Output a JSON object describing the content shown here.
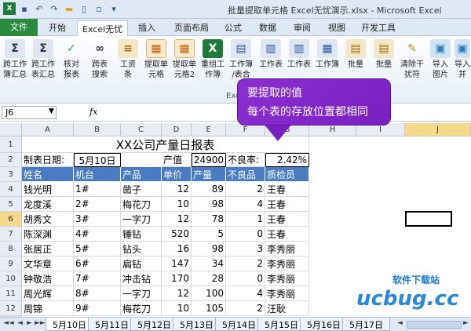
{
  "window": {
    "title": "批量提取单元格 Excel无忧演示.xlsx - Microsoft Excel"
  },
  "tabs": [
    "文件",
    "开始",
    "Excel无忧",
    "插入",
    "页面布局",
    "公式",
    "数据",
    "审阅",
    "视图",
    "开发工具"
  ],
  "ribbon_buttons": [
    {
      "l1": "跨工作",
      "l2": "簿汇总",
      "icon": "sum-icon"
    },
    {
      "l1": "跨工作",
      "l2": "表汇总",
      "icon": "sum-icon"
    },
    {
      "l1": "核对",
      "l2": "报表",
      "icon": "check-icon"
    },
    {
      "l1": "跨表",
      "l2": "搜索",
      "icon": "binoculars-icon"
    },
    {
      "l1": "工资",
      "l2": "条",
      "icon": "payslip-icon"
    },
    {
      "l1": "提取单",
      "l2": "元格",
      "icon": "extract-icon"
    },
    {
      "l1": "提取单",
      "l2": "元格2",
      "icon": "extract-icon"
    },
    {
      "l1": "重组工",
      "l2": "作簿",
      "icon": "excel-icon"
    },
    {
      "l1": "工作簿",
      "l2": "/表合并",
      "icon": "merge-icon"
    },
    {
      "l1": "工作表",
      "l2": "",
      "icon": "sheet-icon"
    },
    {
      "l1": "工作表",
      "l2": "",
      "icon": "sheet-icon"
    },
    {
      "l1": "工作簿",
      "l2": "",
      "icon": "workbook-icon"
    },
    {
      "l1": "批量",
      "l2": "",
      "icon": "batch-icon"
    },
    {
      "l1": "批量",
      "l2": "",
      "icon": "batch-icon"
    },
    {
      "l1": "清除干",
      "l2": "扰符",
      "icon": "broom-icon"
    },
    {
      "l1": "导入",
      "l2": "图片",
      "icon": "image-icon"
    },
    {
      "l1": "导入",
      "l2": "并",
      "icon": "image-icon"
    }
  ],
  "group_label": "Exce",
  "namebox": "J6",
  "fx": "fx",
  "columns": [
    "A",
    "B",
    "C",
    "D",
    "E",
    "F",
    "G",
    "H",
    "I",
    "J"
  ],
  "rows": [
    "1",
    "2",
    "3",
    "4",
    "5",
    "6",
    "7",
    "8",
    "9",
    "10",
    "11",
    "12",
    "13"
  ],
  "report_title": "XX公司产量日报表",
  "row2": {
    "a": "制表日期:",
    "b": "5月10日",
    "d": "产值",
    "e": "24900",
    "f": "不良率:",
    "g": "2.42%"
  },
  "headers": [
    "姓名",
    "机台",
    "产品",
    "单价",
    "产量",
    "不良品",
    "质检员"
  ],
  "table": [
    [
      "钱光明",
      "1#",
      "凿子",
      "12",
      "89",
      "2",
      "王春"
    ],
    [
      "龙度溪",
      "2#",
      "梅花刀",
      "10",
      "98",
      "4",
      "王春"
    ],
    [
      "胡秀文",
      "3#",
      "一字刀",
      "12",
      "78",
      "1",
      "王春"
    ],
    [
      "陈深渊",
      "4#",
      "锤钻",
      "520",
      "5",
      "0",
      "王春"
    ],
    [
      "张居正",
      "5#",
      "钻头",
      "16",
      "98",
      "3",
      "李秀丽"
    ],
    [
      "文华章",
      "6#",
      "扁钻",
      "147",
      "34",
      "2",
      "李秀丽"
    ],
    [
      "钟敬浩",
      "7#",
      "冲击钻",
      "170",
      "28",
      "0",
      "李秀丽"
    ],
    [
      "周光辉",
      "8#",
      "一字刀",
      "12",
      "100",
      "4",
      "李秀丽"
    ],
    [
      "周锦",
      "9#",
      "梅花刀",
      "10",
      "105",
      "2",
      "汪耿"
    ]
  ],
  "callout": {
    "line1": "要提取的值",
    "line2": "每个表的存放位置都相同"
  },
  "sheets": [
    "5月10日",
    "5月11日",
    "5月12日",
    "5月13日",
    "5月14日",
    "5月15日",
    "5月16日",
    "5月17日"
  ],
  "watermark": {
    "line1": "软件下载站",
    "line2": "ucbug.cc"
  }
}
